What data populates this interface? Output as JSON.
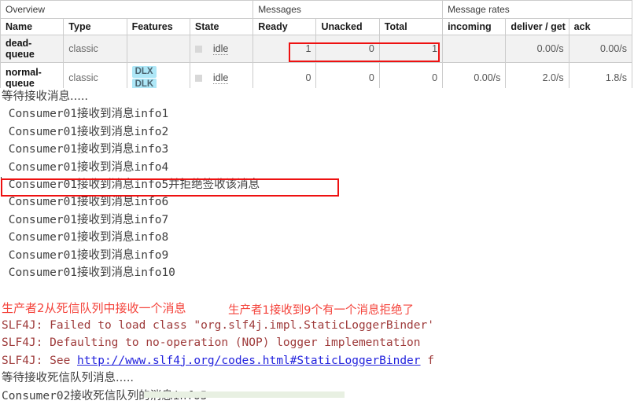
{
  "queues_table": {
    "groups": [
      {
        "label": "Overview",
        "span": 4
      },
      {
        "label": "Messages",
        "span": 3
      },
      {
        "label": "Message rates",
        "span": 3
      }
    ],
    "columns": [
      "Name",
      "Type",
      "Features",
      "State",
      "Ready",
      "Unacked",
      "Total",
      "incoming",
      "deliver / get",
      "ack"
    ],
    "rows": [
      {
        "name": "dead-queue",
        "type": "classic",
        "features": [],
        "state": "idle",
        "ready": "1",
        "unacked": "0",
        "total": "1",
        "incoming": "",
        "deliver_get": "0.00/s",
        "ack": "0.00/s"
      },
      {
        "name": "normal-queue",
        "type": "classic",
        "features": [
          "DLX",
          "DLK"
        ],
        "state": "idle",
        "ready": "0",
        "unacked": "0",
        "total": "0",
        "incoming": "0.00/s",
        "deliver_get": "2.0/s",
        "ack": "1.8/s"
      }
    ]
  },
  "console": {
    "lines": [
      {
        "text": "等待接收消息.....",
        "style": "zh"
      },
      {
        "text": " Consumer01接收到消息info1",
        "style": "mono"
      },
      {
        "text": " Consumer01接收到消息info2",
        "style": "mono"
      },
      {
        "text": " Consumer01接收到消息info3",
        "style": "mono"
      },
      {
        "text": " Consumer01接收到消息info4",
        "style": "mono"
      },
      {
        "text": " Consumer01接收到消息info5并拒绝签收该消息",
        "style": "mono"
      },
      {
        "text": " Consumer01接收到消息info6",
        "style": "mono"
      },
      {
        "text": " Consumer01接收到消息info7",
        "style": "mono"
      },
      {
        "text": " Consumer01接收到消息info8",
        "style": "mono"
      },
      {
        "text": " Consumer01接收到消息info9",
        "style": "mono"
      },
      {
        "text": " Consumer01接收到消息info10",
        "style": "mono"
      },
      {
        "text": "",
        "style": "mono"
      },
      {
        "text": "生产者2从死信队列中接收一个消息",
        "style": "red"
      },
      {
        "text": "SLF4J: Failed to load class \"org.slf4j.impl.StaticLoggerBinder'",
        "style": "slf4j"
      },
      {
        "text": "SLF4J: Defaulting to no-operation (NOP) logger implementation",
        "style": "slf4j"
      },
      {
        "text": "SLF4J: See ",
        "style": "slf4j-link",
        "url": "http://www.slf4j.org/codes.html#StaticLoggerBinder",
        "tail": " f"
      },
      {
        "text": "等待接收死信队列消息.....",
        "style": "zh"
      },
      {
        "text": "Consumer02接收死信队列的消息info5",
        "style": "mono"
      }
    ],
    "annotation": "生产者1接收到9个有一个消息拒绝了"
  },
  "colors": {
    "highlight_box": "#ee1111",
    "badge_bg": "#aee7f7",
    "slf4j_text": "#9e3a3a",
    "link": "#2222dd",
    "annotation": "#f4443c"
  }
}
